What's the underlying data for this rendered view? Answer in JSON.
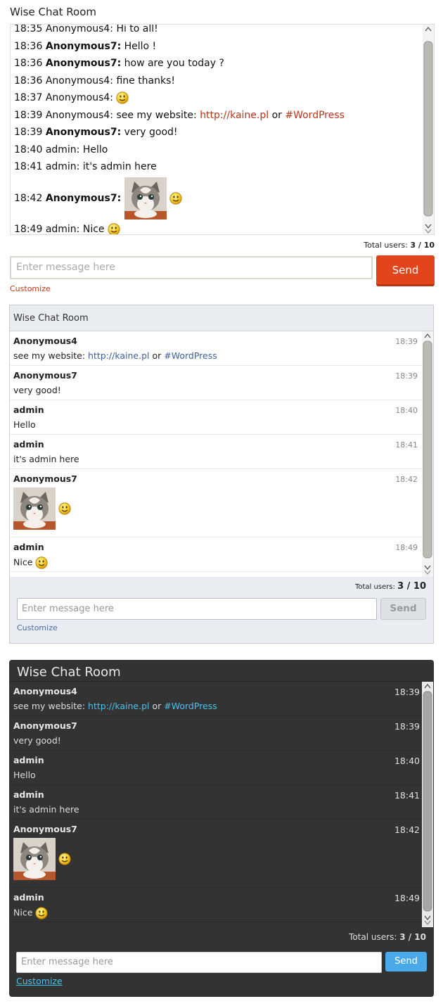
{
  "theme1": {
    "title": "Wise Chat Room",
    "messages": [
      {
        "time": "18:35",
        "sender": "Anonymous4:",
        "text": "Hi to all!"
      },
      {
        "time": "18:36",
        "sender": "Anonymous7:",
        "text": "Hello !"
      },
      {
        "time": "18:36",
        "sender": "Anonymous7:",
        "text": "how are you today ?"
      },
      {
        "time": "18:36",
        "sender": "Anonymous4:",
        "text": "fine thanks!"
      },
      {
        "time": "18:37",
        "sender": "Anonymous4:",
        "text": ""
      },
      {
        "time": "18:39",
        "sender": "Anonymous4:",
        "text": "see my website: ",
        "link": "http://kaine.pl",
        "mid": " or ",
        "hashtag": "#WordPress"
      },
      {
        "time": "18:39",
        "sender": "Anonymous7:",
        "text": "very good!"
      },
      {
        "time": "18:40",
        "sender": "admin:",
        "text": "Hello"
      },
      {
        "time": "18:41",
        "sender": "admin:",
        "text": "it's admin here"
      },
      {
        "time": "18:42",
        "sender": "Anonymous7:",
        "text": ""
      },
      {
        "time": "18:49",
        "sender": "admin:",
        "text": "Nice"
      }
    ],
    "users_label": "Total users:",
    "users_value": "3 / 10",
    "input_placeholder": "Enter message here",
    "send_label": "Send",
    "customize_label": "Customize"
  },
  "theme2": {
    "title": "Wise Chat Room",
    "messages": [
      {
        "sender": "Anonymous4",
        "time": "18:39",
        "text": "see my website: ",
        "link": "http://kaine.pl",
        "mid": " or ",
        "hashtag": "#WordPress"
      },
      {
        "sender": "Anonymous7",
        "time": "18:39",
        "text": "very good!"
      },
      {
        "sender": "admin",
        "time": "18:40",
        "text": "Hello"
      },
      {
        "sender": "admin",
        "time": "18:41",
        "text": "it's admin here"
      },
      {
        "sender": "Anonymous7",
        "time": "18:42",
        "text": ""
      },
      {
        "sender": "admin",
        "time": "18:49",
        "text": "Nice"
      }
    ],
    "users_label": "Total users:",
    "users_value": "3 / 10",
    "input_placeholder": "Enter message here",
    "send_label": "Send",
    "customize_label": "Customize"
  },
  "theme3": {
    "title": "Wise Chat Room",
    "messages": [
      {
        "sender": "Anonymous4",
        "time": "18:39",
        "text": "see my website: ",
        "link": "http://kaine.pl",
        "mid": " or ",
        "hashtag": "#WordPress"
      },
      {
        "sender": "Anonymous7",
        "time": "18:39",
        "text": "very good!"
      },
      {
        "sender": "admin",
        "time": "18:40",
        "text": "Hello"
      },
      {
        "sender": "admin",
        "time": "18:41",
        "text": "it's admin here"
      },
      {
        "sender": "Anonymous7",
        "time": "18:42",
        "text": ""
      },
      {
        "sender": "admin",
        "time": "18:49",
        "text": "Nice"
      }
    ],
    "users_label": "Total users:",
    "users_value": "3 / 10",
    "input_placeholder": "Enter message here",
    "send_label": "Send",
    "customize_label": "Customize"
  },
  "icons": {
    "emoticon": "smiley-icon",
    "attachment": "kitten-image"
  },
  "colors": {
    "theme1_accent": "#e2441c",
    "theme1_link": "#b8341a",
    "theme2_link": "#3d5f9b",
    "theme3_bg": "#333333",
    "theme3_link": "#4ec1e8",
    "theme3_send": "#4aa9e9"
  }
}
